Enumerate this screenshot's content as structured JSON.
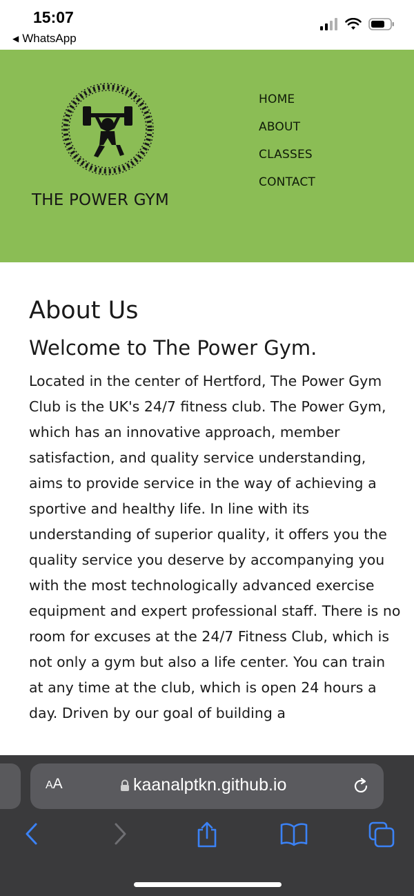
{
  "status_bar": {
    "time": "15:07",
    "back_app": "WhatsApp",
    "icons": [
      "signal-icon",
      "wifi-icon",
      "battery-icon"
    ]
  },
  "header": {
    "logo_text": "THE POWER GYM",
    "background_color": "#8bbd55",
    "nav": [
      {
        "label": "HOME"
      },
      {
        "label": "ABOUT"
      },
      {
        "label": "CLASSES"
      },
      {
        "label": "CONTACT"
      }
    ]
  },
  "main": {
    "title": "About Us",
    "subtitle": "Welcome to The Power Gym.",
    "paragraph": "Located in the center of Hertford, The Power Gym Club is the UK's 24/7 fitness club. The Power Gym, which has an innovative approach, member satisfaction, and quality service understanding, aims to provide service in the way of achieving a sportive and healthy life. In line with its understanding of superior quality, it offers you the quality service you deserve by accompanying you with the most technologically advanced exercise equipment and expert professional staff. There is no room for excuses at the 24/7 Fitness Club, which is not only a gym but also a life center. You can train at any time at the club, which is open 24 hours a day. Driven by our goal of building a"
  },
  "browser": {
    "text_size_small": "A",
    "text_size_large": "A",
    "url": "kaanalptkn.github.io",
    "accent_color": "#3b82f6"
  }
}
